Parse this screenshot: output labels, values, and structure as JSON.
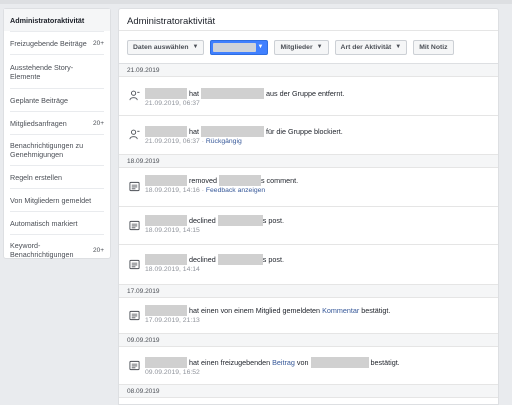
{
  "sidebar": {
    "items": [
      {
        "label": "Administratoraktivität",
        "badge": ""
      },
      {
        "label": "Freizugebende Beiträge",
        "badge": "20+"
      },
      {
        "label": "Ausstehende Story-Elemente",
        "badge": ""
      },
      {
        "label": "Geplante Beiträge",
        "badge": ""
      },
      {
        "label": "Mitgliedsanfragen",
        "badge": "20+"
      },
      {
        "label": "Benachrichtigungen zu Genehmigungen",
        "badge": ""
      },
      {
        "label": "Regeln erstellen",
        "badge": ""
      },
      {
        "label": "Von Mitgliedern gemeldet",
        "badge": ""
      },
      {
        "label": "Automatisch markiert",
        "badge": ""
      },
      {
        "label": "Keyword-Benachrichtigungen",
        "badge": "20+"
      }
    ]
  },
  "main": {
    "title": "Administratoraktivität",
    "filters": {
      "date": "Daten auswählen",
      "members": "Mitglieder",
      "activity_type": "Art der Aktivität",
      "with_note": "Mit Notiz"
    },
    "dates": [
      "21.09.2019",
      "18.09.2019",
      "17.09.2019",
      "09.09.2019",
      "08.09.2019"
    ],
    "entries": [
      {
        "verb": "hat",
        "rest": "aus der Gruppe entfernt.",
        "time": "21.09.2019, 06:37",
        "link": ""
      },
      {
        "verb": "hat",
        "rest": "für die Gruppe blockiert.",
        "time": "21.09.2019, 06:37",
        "link": "Rückgängig"
      },
      {
        "verb": "removed",
        "rest": "s comment.",
        "time": "18.09.2019, 14:16",
        "link": "Feedback anzeigen"
      },
      {
        "verb": "declined",
        "rest": "s post.",
        "time": "18.09.2019, 14:15",
        "link": ""
      },
      {
        "verb": "declined",
        "rest": "s post.",
        "time": "18.09.2019, 14:14",
        "link": ""
      },
      {
        "text1": "hat einen von einem Mitglied gemeldeten",
        "link": "Kommentar",
        "text2": "bestätigt.",
        "time": "17.09.2019, 21:13"
      },
      {
        "text1": "hat einen freizugebenden",
        "link": "Beitrag",
        "text2": "von",
        "text3": "bestätigt.",
        "time": "09.09.2019, 16:52"
      }
    ],
    "separator": "·"
  },
  "icons": {
    "person_remove": "person-remove-icon",
    "log": "activity-log-icon"
  },
  "colors": {
    "accent": "#4080ff",
    "link": "#365899",
    "background": "#e9ebee"
  }
}
